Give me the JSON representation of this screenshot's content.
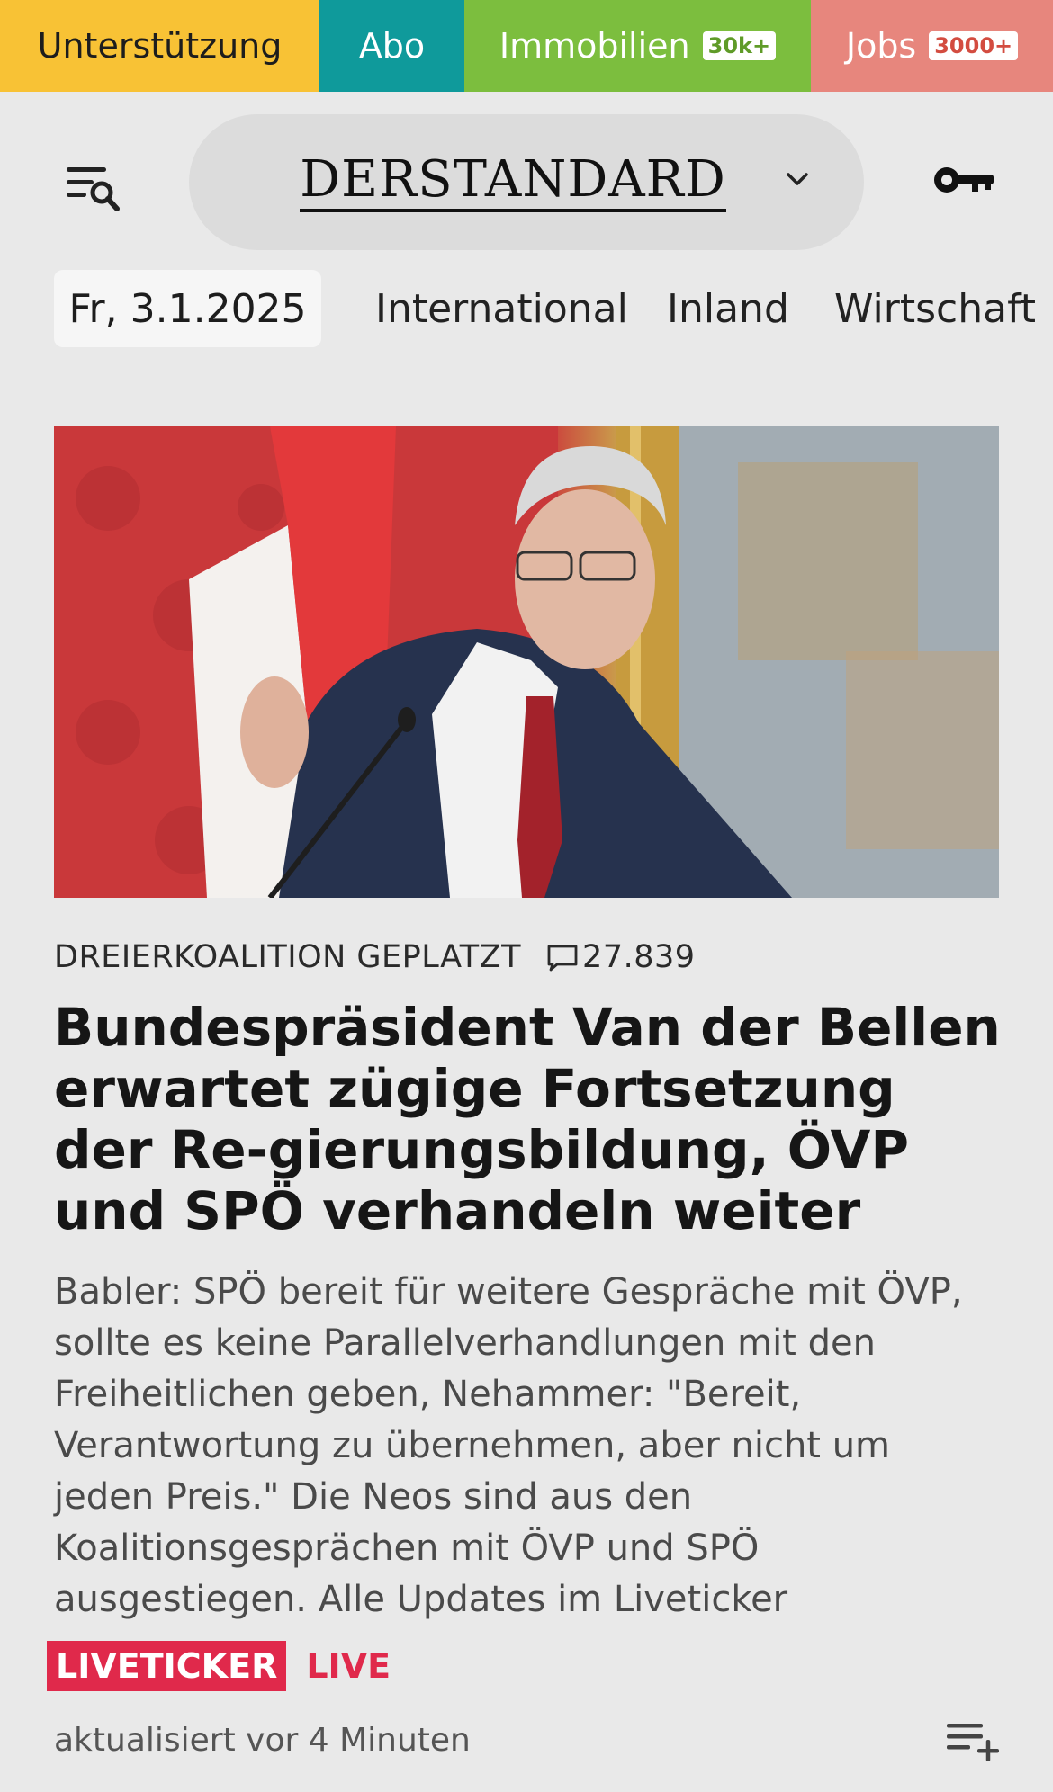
{
  "topbar": {
    "support_label": "Unterstützung",
    "abo_label": "Abo",
    "immobilien_label": "Immobilien",
    "immobilien_badge": "30k+",
    "jobs_label": "Jobs",
    "jobs_badge": "3000+"
  },
  "header": {
    "logo_text": "DERSTANDARD",
    "menu_icon": "menu-search-icon",
    "dropdown_icon": "chevron-down-icon",
    "login_icon": "key-icon"
  },
  "nav": {
    "date": "Fr, 3.1.2025",
    "items": [
      {
        "label": "International"
      },
      {
        "label": "Inland"
      },
      {
        "label": "Wirtschaft"
      }
    ]
  },
  "article": {
    "kicker": "DREIERKOALITION GEPLATZT",
    "comment_count": "27.839",
    "headline": "Bundespräsident Van der Bellen erwartet zügige Fortsetzung der Re-gierungsbildung, ÖVP und SPÖ verhandeln weiter",
    "teaser": "Babler: SPÖ bereit für weitere Gespräche mit ÖVP, sollte es keine Parallelverhandlungen mit den Freiheitlichen geben, Nehammer: \"Bereit, Verantwortung zu übernehmen, aber nicht um jeden Preis.\" Die Neos sind aus den Koalitionsgesprächen mit ÖVP und SPÖ ausgestiegen. Alle Updates im Liveticker",
    "liveticker_label": "LIVETICKER",
    "live_label": "LIVE",
    "updated": "aktualisiert vor 4 Minuten"
  },
  "colors": {
    "support": "#f8c235",
    "abo": "#0f9a9b",
    "immobilien": "#7cbe3e",
    "jobs": "#e7867d",
    "live_accent": "#e0294b",
    "background": "#e9e9e9"
  }
}
